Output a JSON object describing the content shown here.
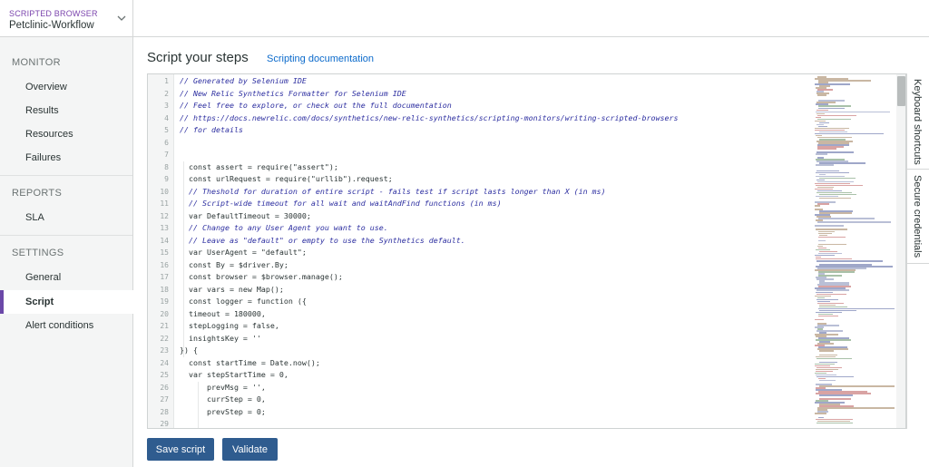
{
  "entity": {
    "type": "SCRIPTED BROWSER",
    "name": "Petclinic-Workflow"
  },
  "sidebar": {
    "sections": [
      {
        "title": "MONITOR",
        "items": [
          "Overview",
          "Results",
          "Resources",
          "Failures"
        ]
      },
      {
        "title": "REPORTS",
        "items": [
          "SLA"
        ]
      },
      {
        "title": "SETTINGS",
        "items": [
          "General",
          "Script",
          "Alert conditions"
        ]
      }
    ],
    "active_item": "Script"
  },
  "main": {
    "title": "Script your steps",
    "doc_link": "Scripting documentation"
  },
  "editor": {
    "line_numbers": [
      "1",
      "2",
      "3",
      "4",
      "5",
      "6",
      "7",
      "8",
      "9",
      "10",
      "11",
      "12",
      "13",
      "14",
      "15",
      "16",
      "17",
      "18",
      "19",
      "20",
      "21",
      "22",
      "23",
      "24",
      "25",
      "26",
      "27",
      "28",
      "29"
    ],
    "lines": [
      "// Generated by Selenium IDE",
      "// New Relic Synthetics Formatter for Selenium IDE",
      "// Feel free to explore, or check out the full documentation",
      "// https://docs.newrelic.com/docs/synthetics/new-relic-synthetics/scripting-monitors/writing-scripted-browsers",
      "// for details",
      "",
      "",
      "  const assert = require(\"assert\");",
      "  const urlRequest = require(\"urllib\").request;",
      "  // Theshold for duration of entire script - fails test if script lasts longer than X (in ms)",
      "  // Script-wide timeout for all wait and waitAndFind functions (in ms)",
      "  var DefaultTimeout = 30000;",
      "  // Change to any User Agent you want to use.",
      "  // Leave as \"default\" or empty to use the Synthetics default.",
      "  var UserAgent = \"default\";",
      "  const By = $driver.By;",
      "  const browser = $browser.manage();",
      "  var vars = new Map();",
      "  const logger = function ({",
      "  timeout = 180000,",
      "  stepLogging = false,",
      "  insightsKey = ''",
      "}) {",
      "  const startTime = Date.now();",
      "  var stepStartTime = 0,",
      "      prevMsg = '',",
      "      currStep = 0,",
      "      prevStep = 0;",
      ""
    ]
  },
  "side_tabs": [
    "Keyboard shortcuts",
    "Secure credentials"
  ],
  "buttons": {
    "save": "Save script",
    "validate": "Validate"
  },
  "colors": {
    "accent": "#6b48a8",
    "button": "#2f5c8f",
    "link": "#0b6acb",
    "comment": "#2c2ea0"
  }
}
